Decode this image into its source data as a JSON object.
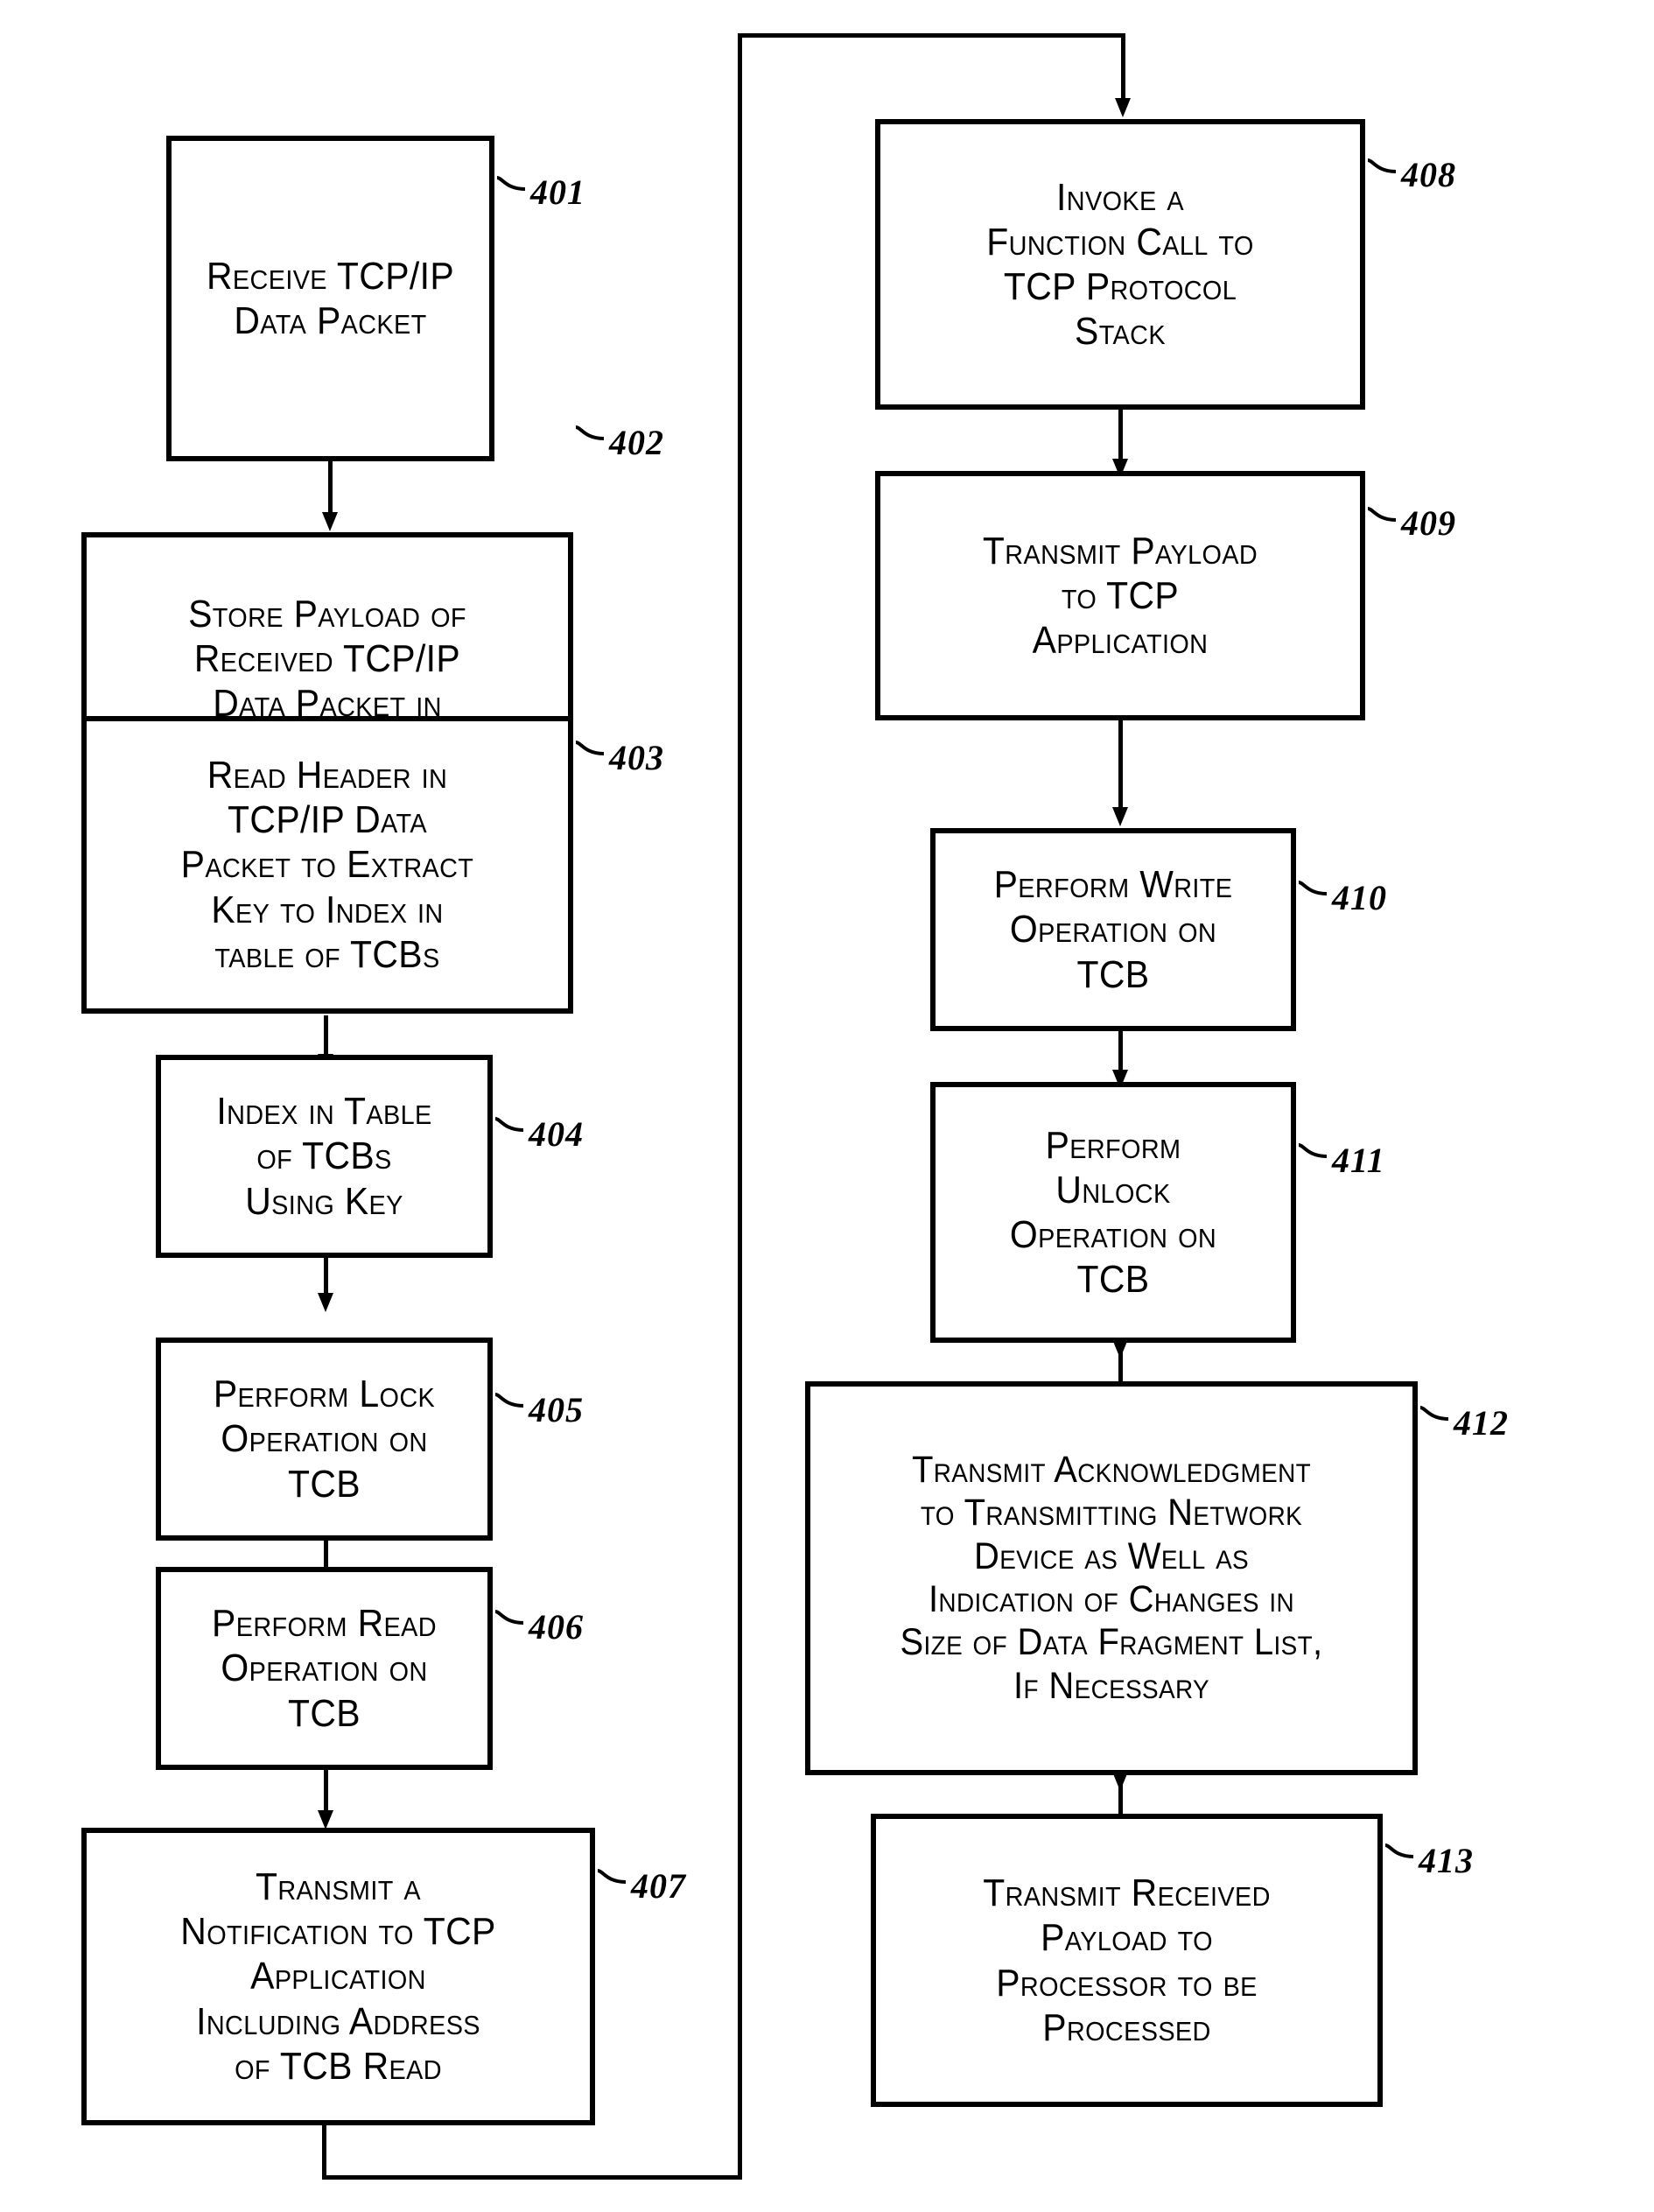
{
  "figure": {
    "type": "patent-flowchart",
    "orientation": "two-column",
    "background_color": "#ffffff",
    "line_color": "#000000"
  },
  "steps": [
    {
      "ref": "401",
      "text": "Receive TCP/IP\nData Packet",
      "column": "left"
    },
    {
      "ref": "402",
      "text": "Store Payload of\nReceived TCP/IP\nData Packet in\nData Fragment List",
      "column": "left"
    },
    {
      "ref": "403",
      "text": "Read Header in\nTCP/IP Data\nPacket to Extract\nKey to Index in\ntable of TCBs",
      "column": "left"
    },
    {
      "ref": "404",
      "text": "Index in Table\nof TCBs\nUsing Key",
      "column": "left"
    },
    {
      "ref": "405",
      "text": "Perform Lock\nOperation on\nTCB",
      "column": "left"
    },
    {
      "ref": "406",
      "text": "Perform Read\nOperation on\nTCB",
      "column": "left"
    },
    {
      "ref": "407",
      "text": "Transmit a\nNotification to TCP\nApplication\nIncluding Address\nof TCB Read",
      "column": "left"
    },
    {
      "ref": "408",
      "text": "Invoke a\nFunction Call to\nTCP Protocol\nStack",
      "column": "right"
    },
    {
      "ref": "409",
      "text": "Transmit Payload\nto TCP\nApplication",
      "column": "right"
    },
    {
      "ref": "410",
      "text": "Perform Write\nOperation on\nTCB",
      "column": "right"
    },
    {
      "ref": "411",
      "text": "Perform\nUnlock\nOperation on\nTCB",
      "column": "right"
    },
    {
      "ref": "412",
      "text": "Transmit Acknowledgment\nto Transmitting Network\nDevice as Well as\nIndication of Changes in\nSize of Data Fragment List,\nIf Necessary",
      "column": "right"
    },
    {
      "ref": "413",
      "text": "Transmit Received\nPayload to\nProcessor to be\nProcessed",
      "column": "right"
    }
  ],
  "connectors": [
    {
      "from": "401",
      "to": "402",
      "kind": "arrow-down"
    },
    {
      "from": "402",
      "to": "403",
      "kind": "arrow-down"
    },
    {
      "from": "403",
      "to": "404",
      "kind": "arrow-down"
    },
    {
      "from": "404",
      "to": "405",
      "kind": "arrow-down"
    },
    {
      "from": "405",
      "to": "406",
      "kind": "arrow-down"
    },
    {
      "from": "406",
      "to": "407",
      "kind": "arrow-down"
    },
    {
      "from": "407",
      "to": "408",
      "kind": "wrap-around-left-top"
    },
    {
      "from": "408",
      "to": "409",
      "kind": "arrow-down"
    },
    {
      "from": "409",
      "to": "410",
      "kind": "arrow-down"
    },
    {
      "from": "410",
      "to": "411",
      "kind": "arrow-down"
    },
    {
      "from": "411",
      "to": "412",
      "kind": "arrow-down"
    },
    {
      "from": "412",
      "to": "413",
      "kind": "arrow-down"
    }
  ]
}
